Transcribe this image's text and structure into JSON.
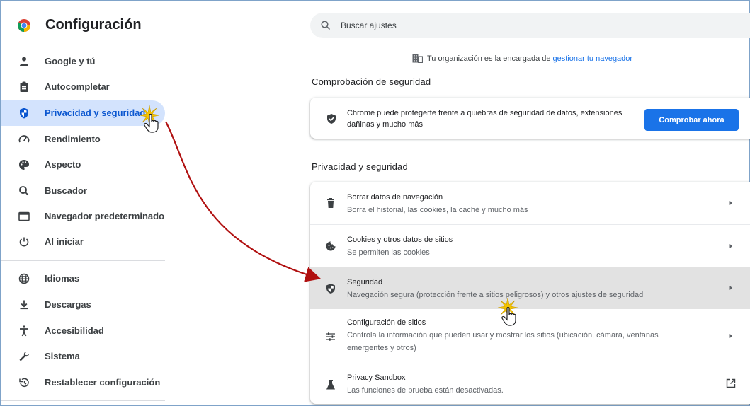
{
  "app": {
    "title": "Configuración"
  },
  "sidebar": {
    "items": [
      {
        "label": "Google y tú",
        "icon": "person-icon"
      },
      {
        "label": "Autocompletar",
        "icon": "clipboard-icon"
      },
      {
        "label": "Privacidad y seguridad",
        "icon": "shield-icon",
        "active": true
      },
      {
        "label": "Rendimiento",
        "icon": "speedometer-icon"
      },
      {
        "label": "Aspecto",
        "icon": "palette-icon"
      },
      {
        "label": "Buscador",
        "icon": "search-icon"
      },
      {
        "label": "Navegador predeterminado",
        "icon": "browser-window-icon"
      },
      {
        "label": "Al iniciar",
        "icon": "power-icon"
      },
      {
        "label": "Idiomas",
        "icon": "globe-icon"
      },
      {
        "label": "Descargas",
        "icon": "download-icon"
      },
      {
        "label": "Accesibilidad",
        "icon": "accessibility-icon"
      },
      {
        "label": "Sistema",
        "icon": "wrench-icon"
      },
      {
        "label": "Restablecer configuración",
        "icon": "restore-icon"
      }
    ]
  },
  "search": {
    "placeholder": "Buscar ajustes"
  },
  "org_notice": {
    "text": "Tu organización es la encargada de ",
    "link": "gestionar tu navegador"
  },
  "safety_check": {
    "title": "Comprobación de seguridad",
    "description": "Chrome puede protegerte frente a quiebras de seguridad de datos, extensiones dañinas y mucho más",
    "button": "Comprobar ahora"
  },
  "privacy": {
    "title": "Privacidad y seguridad",
    "rows": [
      {
        "title": "Borrar datos de navegación",
        "subtitle": "Borra el historial, las cookies, la caché y mucho más",
        "icon": "trash-icon"
      },
      {
        "title": "Cookies y otros datos de sitios",
        "subtitle": "Se permiten las cookies",
        "icon": "cookie-icon"
      },
      {
        "title": "Seguridad",
        "subtitle": "Navegación segura (protección frente a sitios peligrosos) y otros ajustes de seguridad",
        "icon": "security-shield-icon",
        "highlighted": true
      },
      {
        "title": "Configuración de sitios",
        "subtitle": "Controla la información que pueden usar y mostrar los sitios (ubicación, cámara, ventanas emergentes y otros)",
        "icon": "sliders-icon"
      },
      {
        "title": "Privacy Sandbox",
        "subtitle": "Las funciones de prueba están desactivadas.",
        "icon": "flask-icon"
      }
    ]
  },
  "colors": {
    "accent": "#1a73e8",
    "active_bg": "#d3e3fd",
    "annotation_arrow": "#b01010",
    "row_highlight": "#e2e2e2"
  }
}
